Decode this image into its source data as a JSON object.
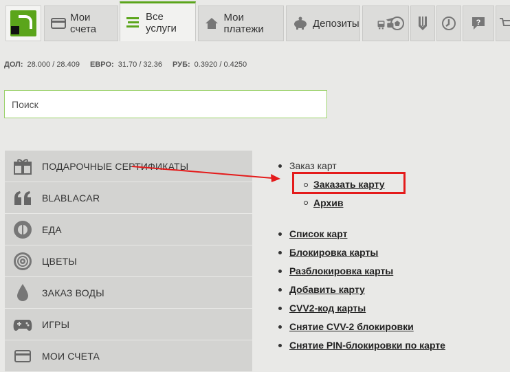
{
  "nav": {
    "tabs": [
      {
        "label": "Мои счета",
        "icon": "card-icon"
      },
      {
        "label": "Все услуги",
        "icon": "list-icon"
      },
      {
        "label": "Мои платежи",
        "icon": "home-icon"
      },
      {
        "label": "Депозиты",
        "icon": "piggy-bank-icon"
      }
    ],
    "icon_tabs": [
      "transport-icon",
      "football-icon",
      "trident-icon",
      "dial-icon",
      "help-icon"
    ]
  },
  "rates": {
    "usd_label": "ДОЛ:",
    "usd_value": "28.000 / 28.409",
    "eur_label": "ЕВРО:",
    "eur_value": "31.70 / 32.36",
    "rub_label": "РУБ:",
    "rub_value": "0.3920 / 0.4250"
  },
  "search": {
    "placeholder": "Поиск"
  },
  "menu": [
    {
      "label": "ПОДАРОЧНЫЕ СЕРТИФИКАТЫ",
      "icon": "gift-icon"
    },
    {
      "label": "BLABLACAR",
      "icon": "quote-icon"
    },
    {
      "label": "ЕДА",
      "icon": "plate-icon"
    },
    {
      "label": "ЦВЕТЫ",
      "icon": "rose-icon"
    },
    {
      "label": "ЗАКАЗ ВОДЫ",
      "icon": "water-drop-icon"
    },
    {
      "label": "ИГРЫ",
      "icon": "gamepad-icon"
    },
    {
      "label": "МОИ СЧЕТА",
      "icon": "card-icon"
    }
  ],
  "links": {
    "group_title": "Заказ карт",
    "sub": [
      "Заказать карту",
      "Архив"
    ],
    "items": [
      "Список карт",
      "Блокировка карты",
      "Разблокировка карты",
      "Добавить карту",
      "CVV2-код карты",
      "Снятие CVV-2 блокировки",
      "Снятие PIN-блокировки по карте"
    ]
  },
  "colors": {
    "brand": "#5ba51b",
    "annotation": "#e41b1b"
  }
}
